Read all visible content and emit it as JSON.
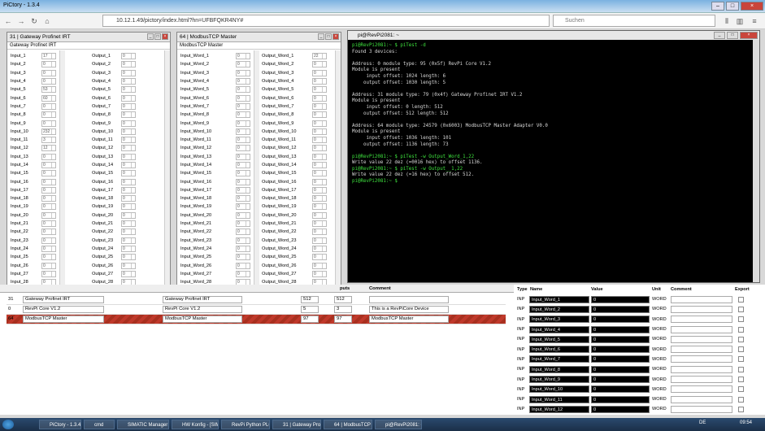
{
  "browser": {
    "title": "PiCtory - 1.3.4",
    "url": "10.12.1.49/pictory/index.html?hn=UFBFQKR4NY#",
    "search_placeholder": "Suchen"
  },
  "gateway": {
    "title": "31 | Gateway Profinet IRT",
    "subtitle": "Gateway Profinet IRT",
    "inputs": [
      [
        "Input_1",
        "17"
      ],
      [
        "Input_2",
        "0"
      ],
      [
        "Input_3",
        "0"
      ],
      [
        "Input_4",
        "0"
      ],
      [
        "Input_5",
        "53"
      ],
      [
        "Input_6",
        "60"
      ],
      [
        "Input_7",
        "0"
      ],
      [
        "Input_8",
        "0"
      ],
      [
        "Input_9",
        "0"
      ],
      [
        "Input_10",
        "232"
      ],
      [
        "Input_11",
        "3"
      ],
      [
        "Input_12",
        "12"
      ],
      [
        "Input_13",
        "0"
      ],
      [
        "Input_14",
        "0"
      ],
      [
        "Input_15",
        "0"
      ],
      [
        "Input_16",
        "0"
      ],
      [
        "Input_17",
        "0"
      ],
      [
        "Input_18",
        "0"
      ],
      [
        "Input_19",
        "0"
      ],
      [
        "Input_20",
        "0"
      ],
      [
        "Input_21",
        "0"
      ],
      [
        "Input_22",
        "0"
      ],
      [
        "Input_23",
        "0"
      ],
      [
        "Input_24",
        "0"
      ],
      [
        "Input_25",
        "0"
      ],
      [
        "Input_26",
        "0"
      ],
      [
        "Input_27",
        "0"
      ],
      [
        "Input_28",
        "0"
      ],
      [
        "Input_29",
        "0"
      ]
    ],
    "outputs": [
      [
        "Output_1",
        "0"
      ],
      [
        "Output_2",
        "0"
      ],
      [
        "Output_3",
        "0"
      ],
      [
        "Output_4",
        "0"
      ],
      [
        "Output_5",
        "0"
      ],
      [
        "Output_6",
        "0"
      ],
      [
        "Output_7",
        "0"
      ],
      [
        "Output_8",
        "0"
      ],
      [
        "Output_9",
        "0"
      ],
      [
        "Output_10",
        "0"
      ],
      [
        "Output_11",
        "0"
      ],
      [
        "Output_12",
        "0"
      ],
      [
        "Output_13",
        "0"
      ],
      [
        "Output_14",
        "0"
      ],
      [
        "Output_15",
        "0"
      ],
      [
        "Output_16",
        "0"
      ],
      [
        "Output_17",
        "0"
      ],
      [
        "Output_18",
        "0"
      ],
      [
        "Output_19",
        "0"
      ],
      [
        "Output_20",
        "0"
      ],
      [
        "Output_21",
        "0"
      ],
      [
        "Output_22",
        "0"
      ],
      [
        "Output_23",
        "0"
      ],
      [
        "Output_24",
        "0"
      ],
      [
        "Output_25",
        "0"
      ],
      [
        "Output_26",
        "0"
      ],
      [
        "Output_27",
        "0"
      ],
      [
        "Output_28",
        "0"
      ],
      [
        "Output_29",
        "0"
      ]
    ]
  },
  "modbus": {
    "title": "64 | ModbusTCP Master",
    "subtitle": "ModbusTCP Master",
    "inputs": [
      [
        "Input_Word_1",
        "0"
      ],
      [
        "Input_Word_2",
        "0"
      ],
      [
        "Input_Word_3",
        "0"
      ],
      [
        "Input_Word_4",
        "0"
      ],
      [
        "Input_Word_5",
        "0"
      ],
      [
        "Input_Word_6",
        "0"
      ],
      [
        "Input_Word_7",
        "0"
      ],
      [
        "Input_Word_8",
        "0"
      ],
      [
        "Input_Word_9",
        "0"
      ],
      [
        "Input_Word_10",
        "0"
      ],
      [
        "Input_Word_11",
        "0"
      ],
      [
        "Input_Word_12",
        "0"
      ],
      [
        "Input_Word_13",
        "0"
      ],
      [
        "Input_Word_14",
        "0"
      ],
      [
        "Input_Word_15",
        "0"
      ],
      [
        "Input_Word_16",
        "0"
      ],
      [
        "Input_Word_17",
        "0"
      ],
      [
        "Input_Word_18",
        "0"
      ],
      [
        "Input_Word_19",
        "0"
      ],
      [
        "Input_Word_20",
        "0"
      ],
      [
        "Input_Word_21",
        "0"
      ],
      [
        "Input_Word_22",
        "0"
      ],
      [
        "Input_Word_23",
        "0"
      ],
      [
        "Input_Word_24",
        "0"
      ],
      [
        "Input_Word_25",
        "0"
      ],
      [
        "Input_Word_26",
        "0"
      ],
      [
        "Input_Word_27",
        "0"
      ],
      [
        "Input_Word_28",
        "0"
      ],
      [
        "Input_Word_29",
        "0"
      ]
    ],
    "outputs": [
      [
        "Output_Word_1",
        "22"
      ],
      [
        "Output_Word_2",
        "0"
      ],
      [
        "Output_Word_3",
        "0"
      ],
      [
        "Output_Word_4",
        "0"
      ],
      [
        "Output_Word_5",
        "0"
      ],
      [
        "Output_Word_6",
        "0"
      ],
      [
        "Output_Word_7",
        "0"
      ],
      [
        "Output_Word_8",
        "0"
      ],
      [
        "Output_Word_9",
        "0"
      ],
      [
        "Output_Word_10",
        "0"
      ],
      [
        "Output_Word_11",
        "0"
      ],
      [
        "Output_Word_12",
        "0"
      ],
      [
        "Output_Word_13",
        "0"
      ],
      [
        "Output_Word_14",
        "0"
      ],
      [
        "Output_Word_15",
        "0"
      ],
      [
        "Output_Word_16",
        "0"
      ],
      [
        "Output_Word_17",
        "0"
      ],
      [
        "Output_Word_18",
        "0"
      ],
      [
        "Output_Word_19",
        "0"
      ],
      [
        "Output_Word_20",
        "0"
      ],
      [
        "Output_Word_21",
        "0"
      ],
      [
        "Output_Word_22",
        "0"
      ],
      [
        "Output_Word_23",
        "0"
      ],
      [
        "Output_Word_24",
        "0"
      ],
      [
        "Output_Word_25",
        "0"
      ],
      [
        "Output_Word_26",
        "0"
      ],
      [
        "Output_Word_27",
        "0"
      ],
      [
        "Output_Word_28",
        "0"
      ],
      [
        "Output_Word_29",
        "0"
      ]
    ]
  },
  "terminal": {
    "title": "pi@RevPi2081: ~",
    "lines": [
      {
        "t": "pi@RevPi2081:~ $ piTest -d",
        "g": true
      },
      {
        "t": "Found 3 devices:",
        "g": false
      },
      {
        "t": "",
        "g": false
      },
      {
        "t": "Address: 0 module type: 95 (0x5f) RevPi Core V1.2",
        "g": false
      },
      {
        "t": "Module is present",
        "g": false
      },
      {
        "t": "     input offset: 1024 length: 6",
        "g": false
      },
      {
        "t": "    output offset: 1030 length: 5",
        "g": false
      },
      {
        "t": "",
        "g": false
      },
      {
        "t": "Address: 31 module type: 79 (0x4f) Gateway Profinet IRT V1.2",
        "g": false
      },
      {
        "t": "Module is present",
        "g": false
      },
      {
        "t": "     input offset: 0 length: 512",
        "g": false
      },
      {
        "t": "    output offset: 512 length: 512",
        "g": false
      },
      {
        "t": "",
        "g": false
      },
      {
        "t": "Address: 64 module type: 24579 (0x6003) ModbusTCP Master Adapter V0.0",
        "g": false
      },
      {
        "t": "Module is present",
        "g": false
      },
      {
        "t": "     input offset: 1036 length: 101",
        "g": false
      },
      {
        "t": "    output offset: 1136 length: 73",
        "g": false
      },
      {
        "t": "",
        "g": false
      },
      {
        "t": "pi@RevPi2081:~ $ piTest -w Output_Word_1,22",
        "g": true
      },
      {
        "t": "Write value 22 dez (=0016 hex) to offset 1136.",
        "g": false
      },
      {
        "t": "pi@RevPi2081:~ $ piTest -w Output__1,22",
        "g": true
      },
      {
        "t": "Write value 22 dez (=16 hex) to offset 512.",
        "g": false
      },
      {
        "t": "pi@RevPi2081:~ $ ",
        "g": true
      }
    ]
  },
  "device_list": {
    "header_inputs": "puts",
    "header_comment": "Comment",
    "rows": [
      {
        "pos": "31",
        "name": "Gateway Profinet IRT",
        "type": "Gateway Profinet IRT",
        "in": "512",
        "out": "512",
        "comment": "",
        "selected": false
      },
      {
        "pos": "0",
        "name": "RevPi Core V1.2",
        "type": "RevPi Core V1.2",
        "in": "5",
        "out": "3",
        "comment": "This is a RevPiCore Device",
        "selected": false
      },
      {
        "pos": "64",
        "name": "ModbusTCP Master",
        "type": "ModbusTCP Master",
        "in": "97",
        "out": "97",
        "comment": "ModbusTCP Master",
        "selected": true
      }
    ]
  },
  "value_editor": {
    "headers": [
      "Type",
      "Name",
      "Value",
      "Unit",
      "Comment",
      "Export"
    ],
    "rows": [
      [
        "INP",
        "Input_Word_1",
        "0",
        "WORD"
      ],
      [
        "INP",
        "Input_Word_2",
        "0",
        "WORD"
      ],
      [
        "INP",
        "Input_Word_3",
        "0",
        "WORD"
      ],
      [
        "INP",
        "Input_Word_4",
        "0",
        "WORD"
      ],
      [
        "INP",
        "Input_Word_5",
        "0",
        "WORD"
      ],
      [
        "INP",
        "Input_Word_6",
        "0",
        "WORD"
      ],
      [
        "INP",
        "Input_Word_7",
        "0",
        "WORD"
      ],
      [
        "INP",
        "Input_Word_8",
        "0",
        "WORD"
      ],
      [
        "INP",
        "Input_Word_9",
        "0",
        "WORD"
      ],
      [
        "INP",
        "Input_Word_10",
        "0",
        "WORD"
      ],
      [
        "INP",
        "Input_Word_11",
        "0",
        "WORD"
      ],
      [
        "INP",
        "Input_Word_12",
        "0",
        "WORD"
      ]
    ]
  },
  "taskbar": {
    "items": [
      "PiCtory - 1.3.4 - Mo...",
      "cmd",
      "SIMATIC Manager - ...",
      "HW Konfig - [SIMA...",
      "RevPi Python PLC L...",
      "31 | Gateway Profine...",
      "64 | ModbusTCP M...",
      "pi@RevPi2081: ~"
    ],
    "lang": "DE",
    "time": "09:54"
  }
}
